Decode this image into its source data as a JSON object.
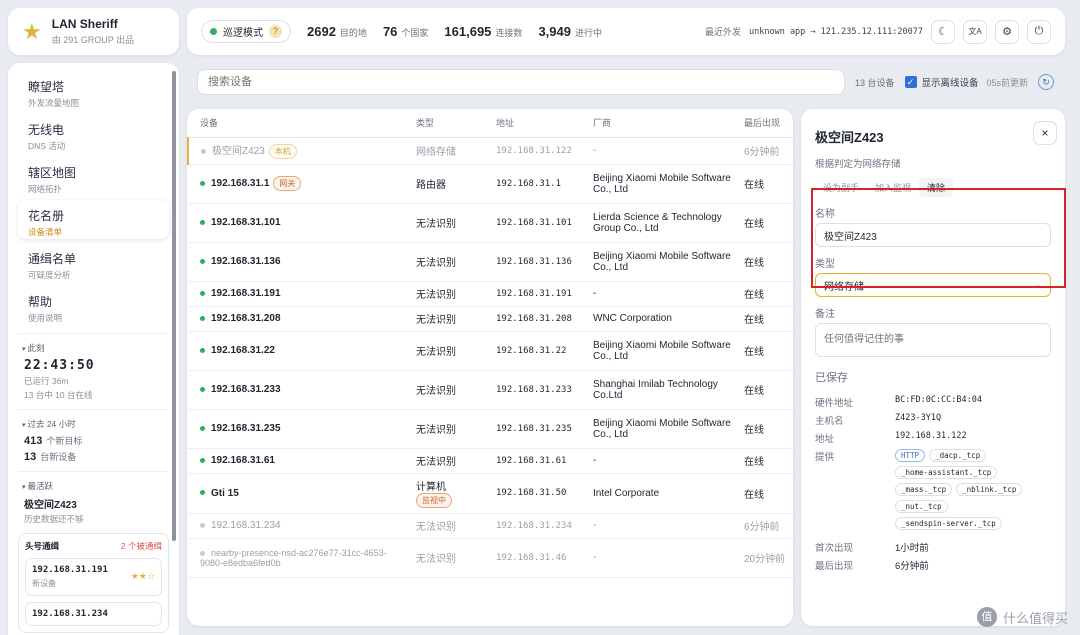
{
  "brand": {
    "title": "LAN Sheriff",
    "subtitle": "由 291 GROUP 出品"
  },
  "topbar": {
    "mode": "巡逻模式",
    "help": "?",
    "stats": [
      {
        "value": "2692",
        "label": "目的地"
      },
      {
        "value": "76",
        "label": "个国家"
      },
      {
        "value": "161,695",
        "label": "连接数"
      },
      {
        "value": "3,949",
        "label": "进行中"
      }
    ],
    "recent_label": "最近外发",
    "recent_value": "unknown app → 121.235.12.111:20077",
    "btn_theme": "☾",
    "btn_lang": "文A",
    "btn_settings": "⚙",
    "btn_power": "⏻"
  },
  "sidebar": {
    "items": [
      {
        "label": "瞭望塔",
        "sub": "外发流量地图"
      },
      {
        "label": "无线电",
        "sub": "DNS 活动"
      },
      {
        "label": "辖区地图",
        "sub": "网络拓扑"
      },
      {
        "label": "花名册",
        "sub": "设备清单"
      },
      {
        "label": "通缉名单",
        "sub": "可疑度分析"
      },
      {
        "label": "帮助",
        "sub": "使用说明"
      }
    ],
    "now_header": "此刻",
    "clock": "22:43:50",
    "uptime": "已运行 36m",
    "online": "13 台中 10 台在线",
    "past_header": "过去 24 小时",
    "new_targets_value": "413",
    "new_targets_label": "个新目标",
    "new_devices_value": "13",
    "new_devices_label": "台新设备",
    "active_header": "最活跃",
    "active_device": "极空间Z423",
    "active_note": "历史数据还不够",
    "wanted_title": "头号通缉",
    "wanted_count": "2 个被通缉",
    "wanted": [
      {
        "ip": "192.168.31.191",
        "sub": "新设备",
        "stars": "★★☆"
      },
      {
        "ip": "192.168.31.234",
        "sub": "",
        "stars": ""
      }
    ]
  },
  "search": {
    "placeholder": "搜索设备",
    "count": "13 台设备",
    "show_offline": "显示离线设备",
    "updated": "05s前更新"
  },
  "table": {
    "headers": [
      "设备",
      "类型",
      "地址",
      "厂商",
      "最后出现"
    ],
    "rows": [
      {
        "name": "极空间Z423",
        "tag": "本机",
        "type": "网络存储",
        "addr": "192.168.31.122",
        "vendor": "-",
        "last": "6分钟前",
        "off": true
      },
      {
        "name": "192.168.31.1",
        "tag": "网关",
        "type": "路由器",
        "addr": "192.168.31.1",
        "vendor": "Beijing Xiaomi Mobile Software Co., Ltd",
        "last": "在线",
        "off": false
      },
      {
        "name": "192.168.31.101",
        "tag": "",
        "type": "无法识别",
        "addr": "192.168.31.101",
        "vendor": "Lierda Science & Technology Group Co., Ltd",
        "last": "在线",
        "off": false
      },
      {
        "name": "192.168.31.136",
        "tag": "",
        "type": "无法识别",
        "addr": "192.168.31.136",
        "vendor": "Beijing Xiaomi Mobile Software Co., Ltd",
        "last": "在线",
        "off": false
      },
      {
        "name": "192.168.31.191",
        "tag": "",
        "type": "无法识别",
        "addr": "192.168.31.191",
        "vendor": "-",
        "last": "在线",
        "off": false
      },
      {
        "name": "192.168.31.208",
        "tag": "",
        "type": "无法识别",
        "addr": "192.168.31.208",
        "vendor": "WNC Corporation",
        "last": "在线",
        "off": false
      },
      {
        "name": "192.168.31.22",
        "tag": "",
        "type": "无法识别",
        "addr": "192.168.31.22",
        "vendor": "Beijing Xiaomi Mobile Software Co., Ltd",
        "last": "在线",
        "off": false
      },
      {
        "name": "192.168.31.233",
        "tag": "",
        "type": "无法识别",
        "addr": "192.168.31.233",
        "vendor": "Shanghai Imilab Technology Co.Ltd",
        "last": "在线",
        "off": false
      },
      {
        "name": "192.168.31.235",
        "tag": "",
        "type": "无法识别",
        "addr": "192.168.31.235",
        "vendor": "Beijing Xiaomi Mobile Software Co., Ltd",
        "last": "在线",
        "off": false
      },
      {
        "name": "192.168.31.61",
        "tag": "",
        "type": "无法识别",
        "addr": "192.168.31.61",
        "vendor": "-",
        "last": "在线",
        "off": false
      },
      {
        "name": "Gti 15",
        "tag": "",
        "type": "计算机",
        "type_tag": "监视中",
        "addr": "192.168.31.50",
        "vendor": "Intel Corporate",
        "last": "在线",
        "off": false
      },
      {
        "name": "192.168.31.234",
        "tag": "",
        "type": "无法识别",
        "addr": "192.168.31.234",
        "vendor": "-",
        "last": "6分钟前",
        "off": true
      },
      {
        "name": "nearby-presence-nsd-ac276e77-31cc-4653-9080-e8edba6fed0b",
        "tag": "",
        "type": "无法识别",
        "addr": "192.168.31.46",
        "vendor": "-",
        "last": "20分钟前",
        "off": true
      }
    ]
  },
  "detail": {
    "title": "极空间Z423",
    "close": "×",
    "subtitle": "根据判定为网络存储",
    "actions": [
      "设为副手",
      "加入监视",
      "清除"
    ],
    "name_label": "名称",
    "name_value": "极空间Z423",
    "type_label": "类型",
    "type_value": "网络存储",
    "note_label": "备注",
    "note_placeholder": "任何值得记住的事",
    "saved": "已保存",
    "mac_label": "硬件地址",
    "mac": "BC:FD:0C:CC:B4:04",
    "host_label": "主机名",
    "host": "Z423-3Y1Q",
    "addr_label": "地址",
    "addr": "192.168.31.122",
    "provides_label": "提供",
    "services": [
      "HTTP",
      "_dacp._tcp",
      "_home-assistant._tcp",
      "_mass._tcp",
      "_nblink._tcp",
      "_nut._tcp",
      "_sendspin-server._tcp"
    ],
    "first_seen_label": "首次出现",
    "first_seen": "1小时前",
    "last_seen_label": "最后出现",
    "last_seen": "6分钟前"
  },
  "watermark": "什么值得买"
}
